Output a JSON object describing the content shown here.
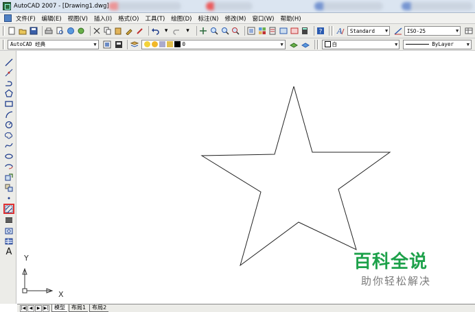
{
  "window": {
    "title": "AutoCAD 2007 - [Drawing1.dwg]"
  },
  "menu": {
    "items": [
      "文件(F)",
      "编辑(E)",
      "视图(V)",
      "插入(I)",
      "格式(O)",
      "工具(T)",
      "绘图(D)",
      "标注(N)",
      "修改(M)",
      "窗口(W)",
      "帮助(H)"
    ]
  },
  "toolbar": {
    "text_style": "Standard",
    "dim_style": "ISO-25"
  },
  "workspace": {
    "name": "AutoCAD 经典"
  },
  "layers": {
    "current": "0",
    "color": "白",
    "linetype": "ByLayer"
  },
  "ucs": {
    "x_label": "X",
    "y_label": "Y"
  },
  "layout_tabs": [
    "模型",
    "布局1",
    "布局2"
  ],
  "watermark": {
    "title": "百科全说",
    "subtitle": "助你轻松解决"
  },
  "colors": {
    "watermark_green": "#1da14a",
    "selected_tool_outline": "#e03030"
  }
}
